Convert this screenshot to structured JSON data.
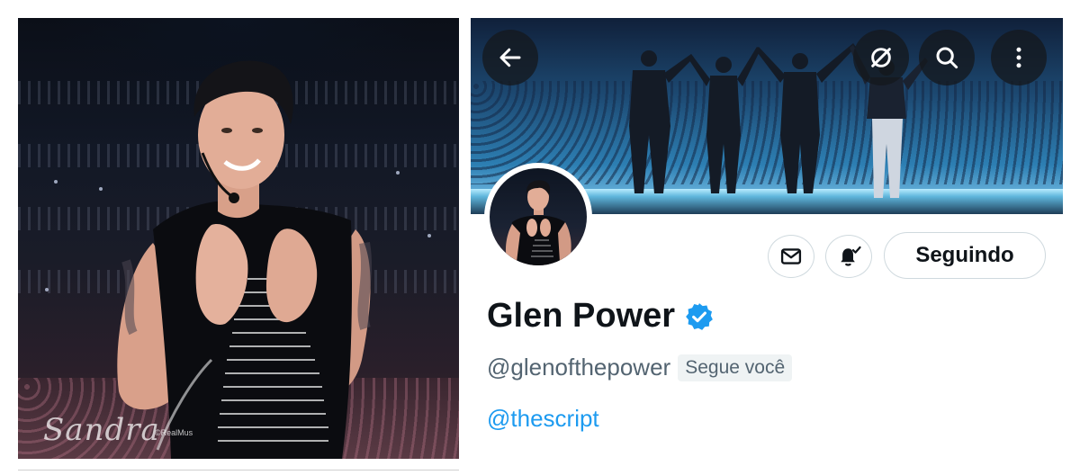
{
  "photo": {
    "watermark_script": "Sandra",
    "watermark_credit": "©RealMus"
  },
  "profile": {
    "nav": {
      "back_icon": "arrow-left-icon",
      "mute_icon": "eye-slash-circle-icon",
      "search_icon": "search-icon",
      "more_icon": "more-vertical-icon"
    },
    "display_name": "Glen Power",
    "verified": true,
    "handle": "@glenofthepower",
    "follows_you": "Segue você",
    "bio_link": "@thescript",
    "actions": {
      "message_icon": "envelope-icon",
      "notify_icon": "bell-check-icon",
      "following_label": "Seguindo"
    }
  },
  "colors": {
    "accent": "#1d9bf0",
    "text_primary": "#0f1419",
    "text_secondary": "#536471",
    "border": "#cfd9de",
    "badge_bg": "#eff3f4"
  }
}
